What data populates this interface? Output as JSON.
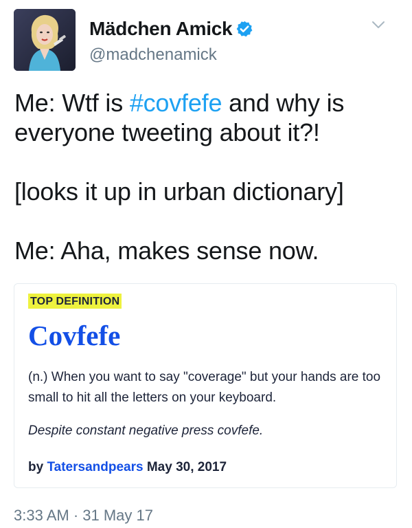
{
  "tweet": {
    "author": {
      "display_name": "Mädchen Amick",
      "handle": "@madchenamick",
      "verified": true,
      "avatar_icon": "profile-photo"
    },
    "menu_icon": "chevron-down-icon",
    "text": {
      "line1_prefix": "Me: Wtf is ",
      "hashtag": "#covfefe",
      "line1_suffix": " and why is everyone tweeting about it?!",
      "line2": "[looks it up in urban dictionary]",
      "line3": "Me: Aha, makes sense now."
    },
    "timestamp": "3:33 AM · 31 May 17"
  },
  "definition_card": {
    "badge": "TOP DEFINITION",
    "word": "Covfefe",
    "meaning": "(n.) When you want to say \"coverage\" but your hands are too small to hit all the letters on your keyboard.",
    "example": "Despite constant negative press covfefe.",
    "by_label": "by",
    "author": "Tatersandpears",
    "date": "May 30, 2017"
  },
  "colors": {
    "hashtag": "#1da1f2",
    "verified_badge": "#1da1f2",
    "secondary_text": "#657786",
    "definition_blue": "#134fe6",
    "badge_yellow": "#eef23f",
    "card_border": "#e6ecf0"
  }
}
